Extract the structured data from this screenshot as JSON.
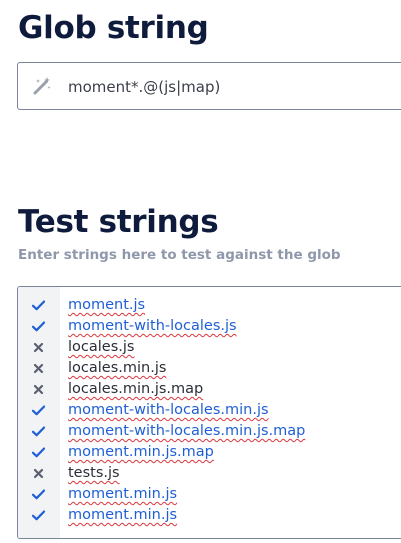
{
  "glob": {
    "title": "Glob string",
    "value": "moment*.@(js|map)",
    "icon": "magic-wand-icon"
  },
  "tests": {
    "title": "Test strings",
    "subtitle": "Enter strings here to test against the glob",
    "colors": {
      "match": "#1f5fd6",
      "nomatch": "#2a2e37",
      "check": "#1f5fd6",
      "cross": "#5a6070"
    },
    "items": [
      {
        "text": "moment.js",
        "matched": true
      },
      {
        "text": "moment-with-locales.js",
        "matched": true
      },
      {
        "text": "locales.js",
        "matched": false
      },
      {
        "text": "locales.min.js",
        "matched": false
      },
      {
        "text": "locales.min.js.map",
        "matched": false
      },
      {
        "text": "moment-with-locales.min.js",
        "matched": true
      },
      {
        "text": "moment-with-locales.min.js.map",
        "matched": true
      },
      {
        "text": "moment.min.js.map",
        "matched": true
      },
      {
        "text": "tests.js",
        "matched": false
      },
      {
        "text": "moment.min.js",
        "matched": true
      },
      {
        "text": "moment.min.js",
        "matched": true
      }
    ]
  }
}
